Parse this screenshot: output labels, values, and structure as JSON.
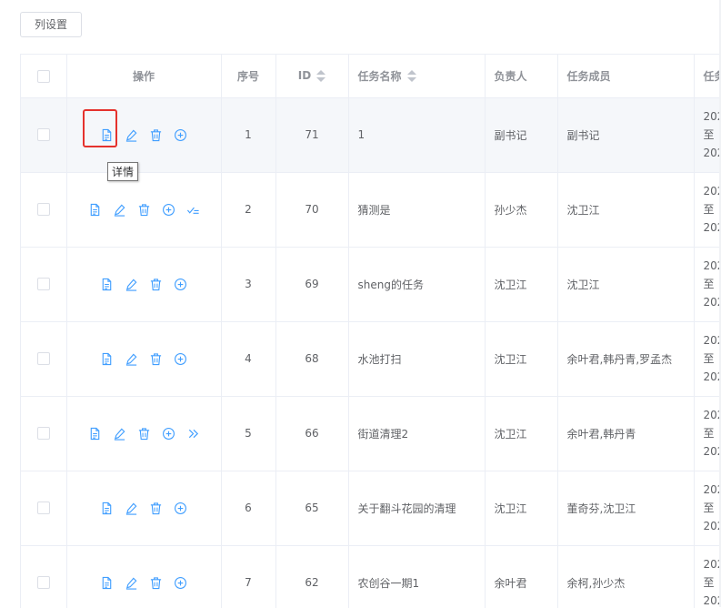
{
  "toolbar": {
    "column_settings_label": "列设置"
  },
  "table": {
    "headers": {
      "operations": "操作",
      "seq": "序号",
      "id": "ID",
      "task_name": "任务名称",
      "owner": "负责人",
      "members": "任务成员",
      "time": "任务"
    },
    "rows": [
      {
        "seq": "1",
        "id": "71",
        "name": "1",
        "owner": "副书记",
        "members": "副书记",
        "time_top": "202",
        "time_mid": "至",
        "time_bot": "202",
        "extra_icon": ""
      },
      {
        "seq": "2",
        "id": "70",
        "name": "猜测是",
        "owner": "孙少杰",
        "members": "沈卫江",
        "time_top": "202",
        "time_mid": "至",
        "time_bot": "202",
        "extra_icon": "check-list-icon"
      },
      {
        "seq": "3",
        "id": "69",
        "name": "sheng的任务",
        "owner": "沈卫江",
        "members": "沈卫江",
        "time_top": "202",
        "time_mid": "至",
        "time_bot": "202",
        "extra_icon": ""
      },
      {
        "seq": "4",
        "id": "68",
        "name": "水池打扫",
        "owner": "沈卫江",
        "members": "余叶君,韩丹青,罗孟杰",
        "time_top": "202",
        "time_mid": "至",
        "time_bot": "202",
        "extra_icon": ""
      },
      {
        "seq": "5",
        "id": "66",
        "name": "街道清理2",
        "owner": "沈卫江",
        "members": "余叶君,韩丹青",
        "time_top": "202",
        "time_mid": "至",
        "time_bot": "202",
        "extra_icon": "double-chevron-right-icon"
      },
      {
        "seq": "6",
        "id": "65",
        "name": "关于翻斗花园的清理",
        "owner": "沈卫江",
        "members": "董奇芬,沈卫江",
        "time_top": "202",
        "time_mid": "至",
        "time_bot": "202",
        "extra_icon": ""
      },
      {
        "seq": "7",
        "id": "62",
        "name": "农创谷一期1",
        "owner": "余叶君",
        "members": "余柯,孙少杰",
        "time_top": "202",
        "time_mid": "至",
        "time_bot": "202",
        "extra_icon": ""
      }
    ]
  },
  "tooltip": {
    "text": "详情"
  },
  "colors": {
    "icon_blue": "#409eff",
    "highlight_red": "#e5322d"
  }
}
